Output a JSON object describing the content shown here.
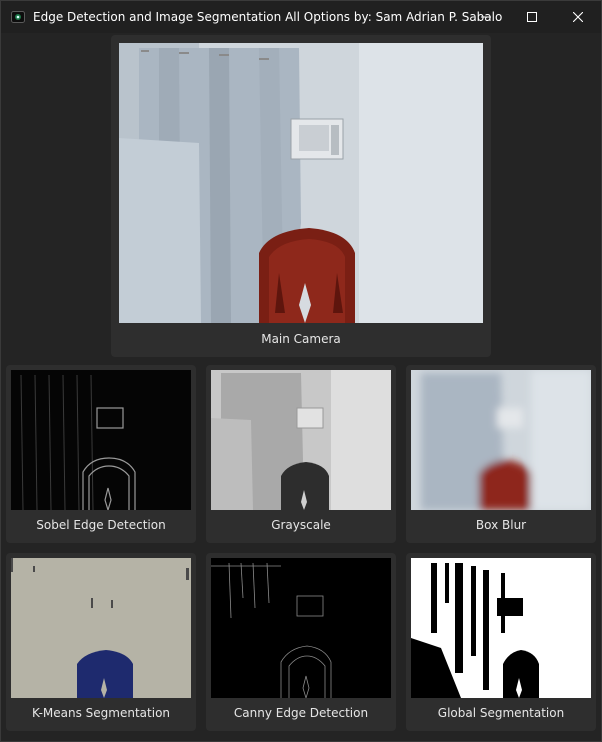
{
  "window": {
    "title": "Edge Detection and Image Segmentation All Options by: Sam Adrian P. Sabalo",
    "icon": "camera-app-icon",
    "controls": [
      "minimize-icon",
      "maximize-icon",
      "close-icon"
    ]
  },
  "main_view": {
    "label": "Main Camera"
  },
  "panels": [
    {
      "label": "Sobel Edge Detection"
    },
    {
      "label": "Grayscale"
    },
    {
      "label": "Box Blur"
    },
    {
      "label": "K-Means Segmentation"
    },
    {
      "label": "Canny Edge Detection"
    },
    {
      "label": "Global Segmentation"
    }
  ]
}
